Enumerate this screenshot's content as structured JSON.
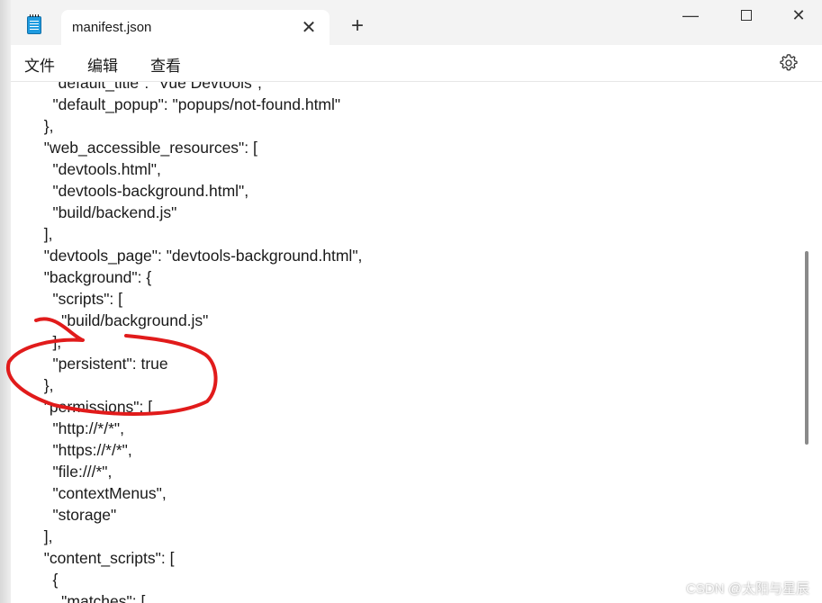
{
  "window": {
    "tab_title": "manifest.json",
    "close_tab_symbol": "✕",
    "new_tab_symbol": "+",
    "minimize_symbol": "—",
    "close_symbol": "✕"
  },
  "menu": {
    "file": "文件",
    "edit": "编辑",
    "view": "查看"
  },
  "icons": {
    "app": "notepad-icon",
    "settings": "gear-icon"
  },
  "editor": {
    "content": "    \"default_title\": \"Vue Devtools\",\n    \"default_popup\": \"popups/not-found.html\"\n  },\n  \"web_accessible_resources\": [\n    \"devtools.html\",\n    \"devtools-background.html\",\n    \"build/backend.js\"\n  ],\n  \"devtools_page\": \"devtools-background.html\",\n  \"background\": {\n    \"scripts\": [\n      \"build/background.js\"\n    ],\n    \"persistent\": true\n  },\n  \"permissions\": [\n    \"http://*/*\",\n    \"https://*/*\",\n    \"file:///*\",\n    \"contextMenus\",\n    \"storage\"\n  ],\n  \"content_scripts\": [\n    {\n      \"matches\": ["
  },
  "annotation_color": "#e11b1b",
  "watermark": "CSDN @太阳与星辰"
}
